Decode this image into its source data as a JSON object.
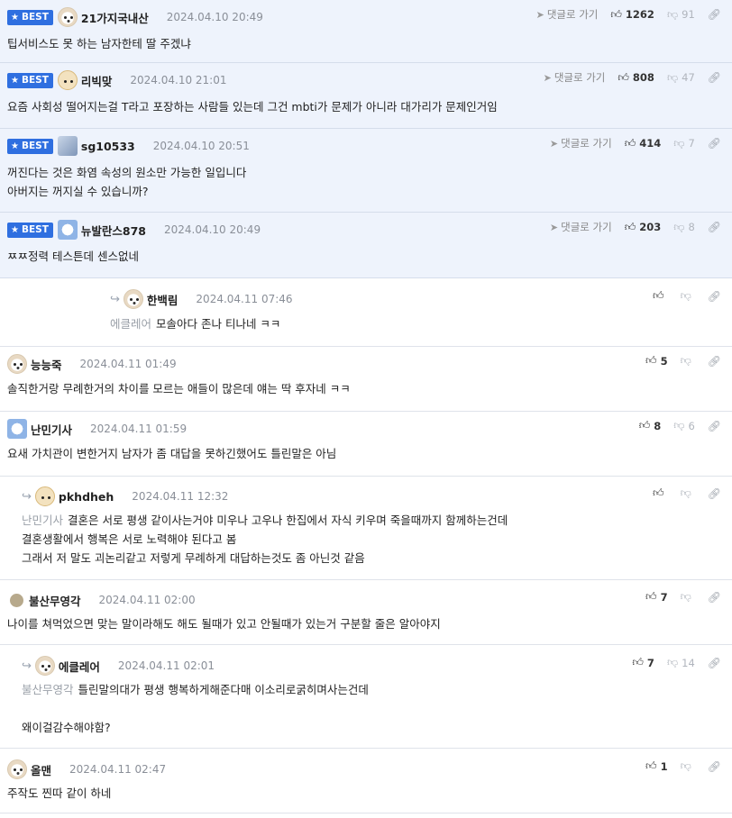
{
  "best_label": "BEST",
  "reply_link_label": "댓글로 가기",
  "comments": [
    {
      "nick": "21가지국내산",
      "date": "2024.04.10 20:49",
      "lines": [
        "팁서비스도 못 하는 남자한테 딸 주겠냐"
      ],
      "up": "1262",
      "down": "91"
    },
    {
      "nick": "리빅맞",
      "date": "2024.04.10 21:01",
      "lines": [
        "요즘 사회성 떨어지는걸 T라고 포장하는 사람들 있는데 그건 mbti가 문제가 아니라 대가리가 문제인거임"
      ],
      "up": "808",
      "down": "47"
    },
    {
      "nick": "sg10533",
      "date": "2024.04.10 20:51",
      "lines": [
        "꺼진다는 것은 화염 속성의 원소만 가능한 일입니다",
        "아버지는 꺼지실 수 있습니까?"
      ],
      "up": "414",
      "down": "7"
    },
    {
      "nick": "뉴발란스878",
      "date": "2024.04.10 20:49",
      "lines": [
        "ㅉㅉ정력 테스튼데 센스없네"
      ],
      "up": "203",
      "down": "8"
    },
    {
      "nick": "한백림",
      "date": "2024.04.11 07:46",
      "mention": "에클레어",
      "lines": [
        "모솔아다 존나 티나네 ㅋㅋ"
      ],
      "up": "",
      "down": ""
    },
    {
      "nick": "능능죽",
      "date": "2024.04.11 01:49",
      "lines": [
        "솔직한거랑 무례한거의 차이를 모르는 애들이 많은데 얘는 딱 후자네 ㅋㅋ"
      ],
      "up": "5",
      "down": ""
    },
    {
      "nick": "난민기사",
      "date": "2024.04.11 01:59",
      "lines": [
        "요새 가치관이 변한거지 남자가 좀 대답을 못하긴했어도 틀린말은 아님"
      ],
      "up": "8",
      "down": "6"
    },
    {
      "nick": "pkhdheh",
      "date": "2024.04.11 12:32",
      "mention": "난민기사",
      "lines": [
        "결혼은 서로 평생 같이사는거야 미우나 고우나 한집에서 자식 키우며 죽을때까지 함께하는건데",
        "결혼생활에서 행복은 서로 노력해야 된다고 봄",
        "그래서 저 말도 괴논리같고 저렇게 무례하게 대답하는것도 좀 아닌것 같음"
      ],
      "up": "",
      "down": ""
    },
    {
      "nick": "불산무영각",
      "date": "2024.04.11 02:00",
      "lines": [
        "나이를 쳐먹었으면 맞는 말이라해도 해도 될때가 있고 안될때가 있는거 구분할 줄은 알아야지"
      ],
      "up": "7",
      "down": ""
    },
    {
      "nick": "에클레어",
      "date": "2024.04.11 02:01",
      "mention": "불산무영각",
      "lines": [
        "틀린말의대가 평생 행복하게해준다매 이소리로굵히며사는건데",
        "",
        "왜이걸감수해야함?"
      ],
      "up": "7",
      "down": "14"
    },
    {
      "nick": "올맨",
      "date": "2024.04.11 02:47",
      "lines": [
        "주작도 찐따 같이 하네"
      ],
      "up": "1",
      "down": ""
    }
  ]
}
